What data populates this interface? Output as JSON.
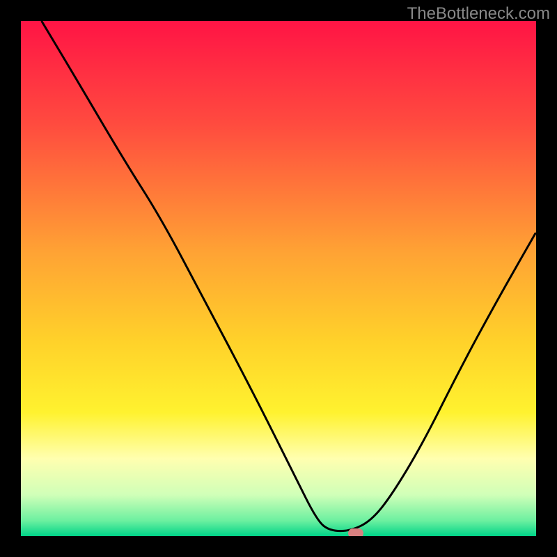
{
  "watermark": "TheBottleneck.com",
  "chart_data": {
    "type": "line",
    "title": "",
    "xlabel": "",
    "ylabel": "",
    "xlim": [
      0,
      100
    ],
    "ylim": [
      0,
      100
    ],
    "series": [
      {
        "name": "curve",
        "x": [
          4,
          10,
          20,
          27,
          35,
          45,
          53,
          57.5,
          60,
          64,
          68,
          72,
          78,
          85,
          92,
          100
        ],
        "y": [
          100,
          90,
          73,
          62,
          47,
          28,
          12,
          3,
          1,
          1,
          3,
          8,
          18,
          32,
          45,
          59
        ]
      }
    ],
    "marker": {
      "x": 65,
      "y": 0.5,
      "color": "#d88080"
    },
    "gradient_stops": [
      {
        "pos": 0,
        "color": "#ff1445"
      },
      {
        "pos": 20,
        "color": "#ff4b3f"
      },
      {
        "pos": 45,
        "color": "#ffa334"
      },
      {
        "pos": 62,
        "color": "#ffd12a"
      },
      {
        "pos": 76,
        "color": "#fff22f"
      },
      {
        "pos": 85,
        "color": "#ffffb0"
      },
      {
        "pos": 92,
        "color": "#d0ffb8"
      },
      {
        "pos": 97,
        "color": "#6cf0a0"
      },
      {
        "pos": 100,
        "color": "#00d488"
      }
    ]
  }
}
